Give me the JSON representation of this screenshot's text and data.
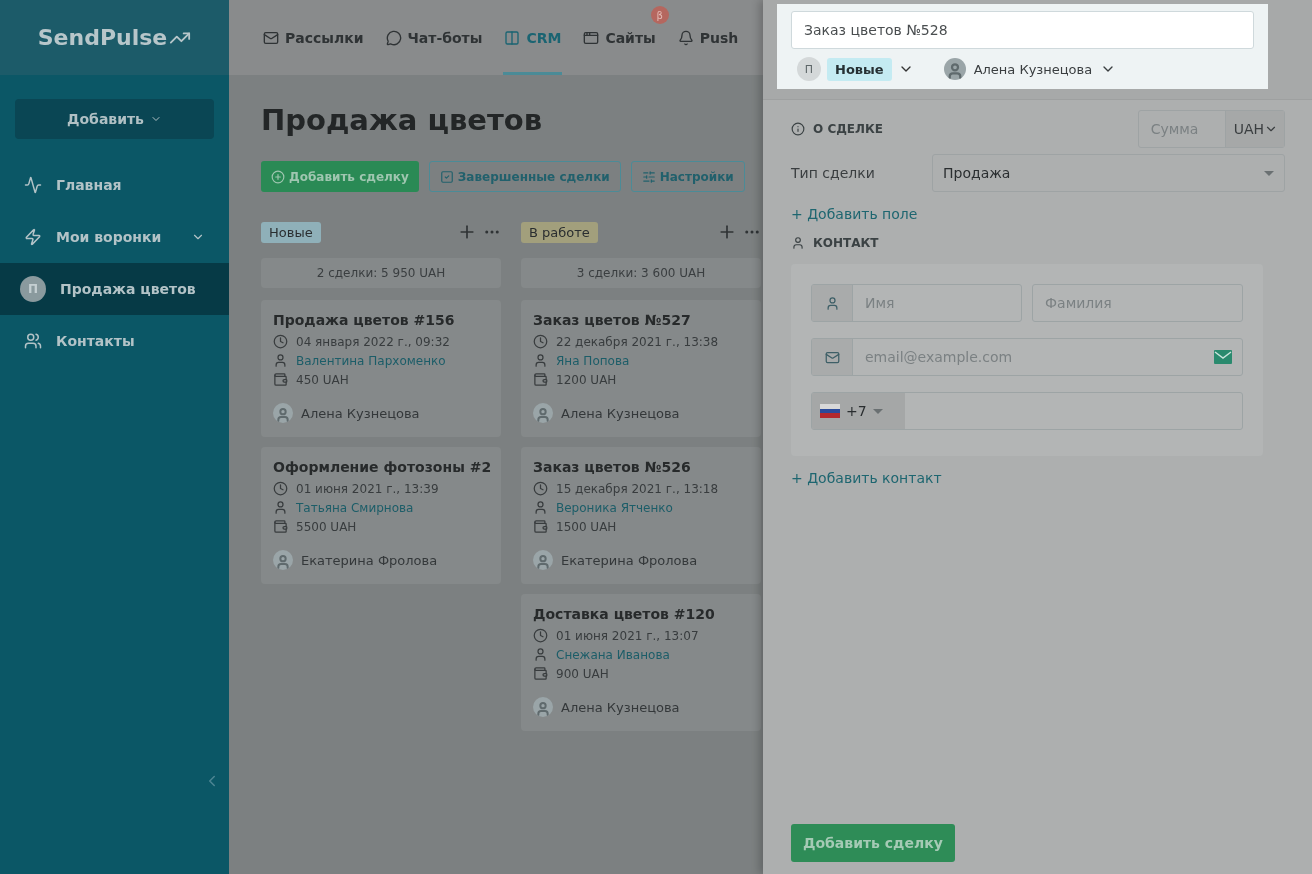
{
  "logo": "SendPulse",
  "sidebar": {
    "add_button": "Добавить",
    "items": [
      {
        "kind": "link",
        "label": "Главная",
        "selected": false
      },
      {
        "kind": "dropdown",
        "label": "Мои воронки",
        "selected": false
      },
      {
        "kind": "avatar",
        "avatar": "П",
        "label": "Продажа цветов",
        "selected": true
      },
      {
        "kind": "link",
        "label": "Контакты",
        "selected": false
      }
    ]
  },
  "nav": [
    {
      "label": "Рассылки",
      "selected": false
    },
    {
      "label": "Чат-боты",
      "selected": false
    },
    {
      "label": "CRM",
      "selected": true
    },
    {
      "label": "Сайты",
      "selected": false,
      "badge": "β"
    },
    {
      "label": "Push",
      "selected": false
    }
  ],
  "page": {
    "title": "Продажа цветов",
    "buttons": [
      {
        "kind": "primary",
        "label": "Добавить сделку"
      },
      {
        "kind": "outline",
        "label": "Завершенные сделки"
      },
      {
        "kind": "outline",
        "label": "Настройки"
      }
    ],
    "columns": [
      {
        "name": "Новые",
        "color": "#8fb0b9",
        "summary": "2 сделки: 5 950 UAH",
        "deals": [
          {
            "title": "Продажа цветов #156",
            "date": "04 января 2022 г., 09:32",
            "contact": "Валентина Пархоменко",
            "amount": "450 UAH",
            "manager": "Алена Кузнецова"
          },
          {
            "title": "Оформление фотозоны #2",
            "date": "01 июня 2021 г., 13:39",
            "contact": "Татьяна Смирнова",
            "amount": "5500 UAH",
            "manager": "Екатерина Фролова"
          }
        ]
      },
      {
        "name": "В работе",
        "color": "#a29f7c",
        "summary": "3 сделки: 3 600 UAH",
        "deals": [
          {
            "title": "Заказ цветов №527",
            "date": "22 декабря 2021 г., 13:38",
            "contact": "Яна Попова",
            "amount": "1200 UAH",
            "manager": "Алена Кузнецова"
          },
          {
            "title": "Заказ цветов №526",
            "date": "15 декабря 2021 г., 13:18",
            "contact": "Вероника Ятченко",
            "amount": "1500 UAH",
            "manager": "Екатерина Фролова"
          },
          {
            "title": "Доставка цветов #120",
            "date": "01 июня 2021 г., 13:07",
            "contact": "Снежана Иванова",
            "amount": "900 UAH",
            "manager": "Алена Кузнецова"
          }
        ]
      }
    ]
  },
  "panel": {
    "title_value": "Заказ цветов №528",
    "stage_avatar": "П",
    "stage": "Новые",
    "manager": "Алена Кузнецова",
    "deal_section": "О СДЕЛКЕ",
    "sum_placeholder": "Сумма",
    "currency": "UAH",
    "type_label": "Тип сделки",
    "type_value": "Продажа",
    "add_field": "+ Добавить поле",
    "contact_section": "КОНТАКТ",
    "name_placeholder": "Имя",
    "surname_placeholder": "Фамилия",
    "email_placeholder": "email@example.com",
    "phone_code": "+7",
    "add_contact": "+ Добавить контакт",
    "submit": "Добавить сделку"
  }
}
